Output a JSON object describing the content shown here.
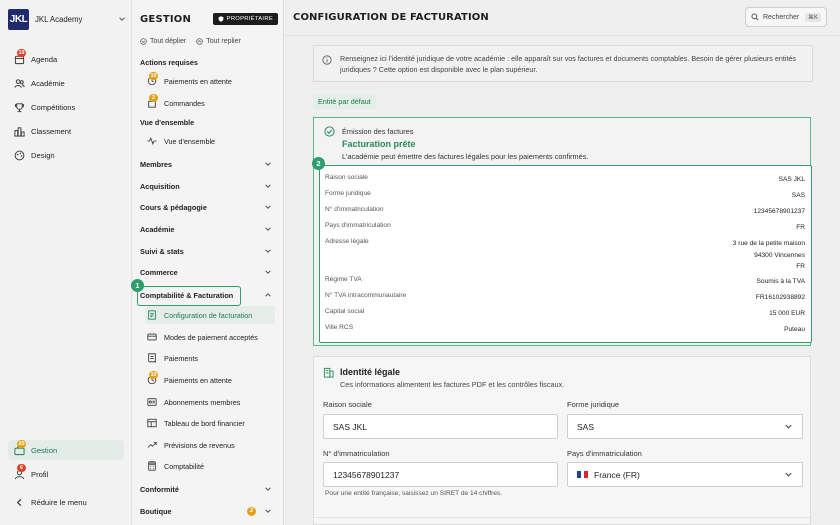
{
  "app": {
    "name": "JKL Academy",
    "logo_text": "JKL"
  },
  "rail": {
    "items": [
      {
        "label": "Agenda",
        "badge": "19",
        "icon": "calendar-icon"
      },
      {
        "label": "Académie",
        "icon": "users-icon"
      },
      {
        "label": "Compétitions",
        "icon": "trophy-icon"
      },
      {
        "label": "Classement",
        "icon": "ranking-icon"
      },
      {
        "label": "Design",
        "icon": "palette-icon"
      }
    ],
    "bottom": [
      {
        "label": "Gestion",
        "badge": "20",
        "icon": "briefcase-icon"
      },
      {
        "label": "Profil",
        "badge": "6",
        "icon": "user-icon"
      },
      {
        "label": "Réduire le menu",
        "icon": "chevron-left-icon"
      }
    ]
  },
  "nav": {
    "title": "GESTION",
    "owner_label": "PROPRIÉTAIRE",
    "expand_all": "Tout déplier",
    "collapse_all": "Tout replier",
    "sections": {
      "actions": "Actions requises",
      "overview": "Vue d'ensemble"
    },
    "actions_items": [
      {
        "label": "Paiements en attente",
        "badge": "10"
      },
      {
        "label": "Commandes",
        "badge": "2"
      }
    ],
    "overview_item": "Vue d'ensemble",
    "groups": [
      "Membres",
      "Acquisition",
      "Cours & pédagogie",
      "Académie",
      "Suivi & stats",
      "Commerce",
      "Comptabilité & Facturation"
    ],
    "billing_items": [
      {
        "label": "Configuration de facturation",
        "icon": "invoice-icon"
      },
      {
        "label": "Modes de paiement acceptés",
        "icon": "card-icon"
      },
      {
        "label": "Paiements",
        "icon": "receipt-icon"
      },
      {
        "label": "Paiements en attente",
        "badge": "10",
        "icon": "clock-icon"
      },
      {
        "label": "Abonnements membres",
        "icon": "subscription-icon"
      },
      {
        "label": "Tableau de bord financier",
        "icon": "dashboard-icon"
      },
      {
        "label": "Prévisions de revenus",
        "icon": "trend-icon"
      },
      {
        "label": "Comptabilité",
        "icon": "calculator-icon"
      }
    ],
    "bottom_groups": [
      {
        "label": "Conformité"
      },
      {
        "label": "Boutique",
        "badge": "2"
      }
    ],
    "callout_1": "1"
  },
  "main": {
    "title": "CONFIGURATION DE FACTURATION",
    "search_label": "Rechercher",
    "search_kbd": "⌘K",
    "info_text": "Renseignez ici l'identité juridique de votre académie : elle apparaît sur vos factures et documents comptables. Besoin de gérer plusieurs entités juridiques ? Cette option est disponible avec le plan supérieur.",
    "default_tag": "Entité par défaut",
    "issuing": {
      "kicker": "Émission des factures",
      "title": "Facturation prête",
      "desc": "L'académie peut émettre des factures légales pour les paiements confirmés.",
      "callout_2": "2",
      "rows": [
        {
          "label": "Raison sociale",
          "value": "SAS JKL"
        },
        {
          "label": "Forme juridique",
          "value": "SAS"
        },
        {
          "label": "N° d'immatriculation",
          "value": "12345678901237"
        },
        {
          "label": "Pays d'immatriculation",
          "value": "FR"
        },
        {
          "label": "Adresse légale",
          "value_lines": [
            "3 rue de la petite maison",
            "94300 Vincennes",
            "FR"
          ]
        },
        {
          "label": "Régime TVA",
          "value": "Soumis à la TVA"
        },
        {
          "label": "N° TVA intracommunautaire",
          "value": "FR16102938892"
        },
        {
          "label": "Capital social",
          "value": "15 000 EUR"
        },
        {
          "label": "Ville RCS",
          "value": "Puteau"
        }
      ]
    },
    "identity": {
      "title": "Identité légale",
      "desc": "Ces informations alimentent les factures PDF et les contrôles fiscaux.",
      "fields": {
        "company_label": "Raison sociale",
        "company_value": "SAS JKL",
        "form_label": "Forme juridique",
        "form_value": "SAS",
        "reg_label": "N° d'immatriculation",
        "reg_value": "12345678901237",
        "country_label": "Pays d'immatriculation",
        "country_value": "France (FR)"
      },
      "hint": "Pour une entité française, saisissez un SIRET de 14 chiffres."
    }
  },
  "colors": {
    "accent_green": "#2f9e6d",
    "badge_red": "#e0412b",
    "badge_orange": "#e3a21a",
    "logo_navy": "#1f2b6e"
  }
}
